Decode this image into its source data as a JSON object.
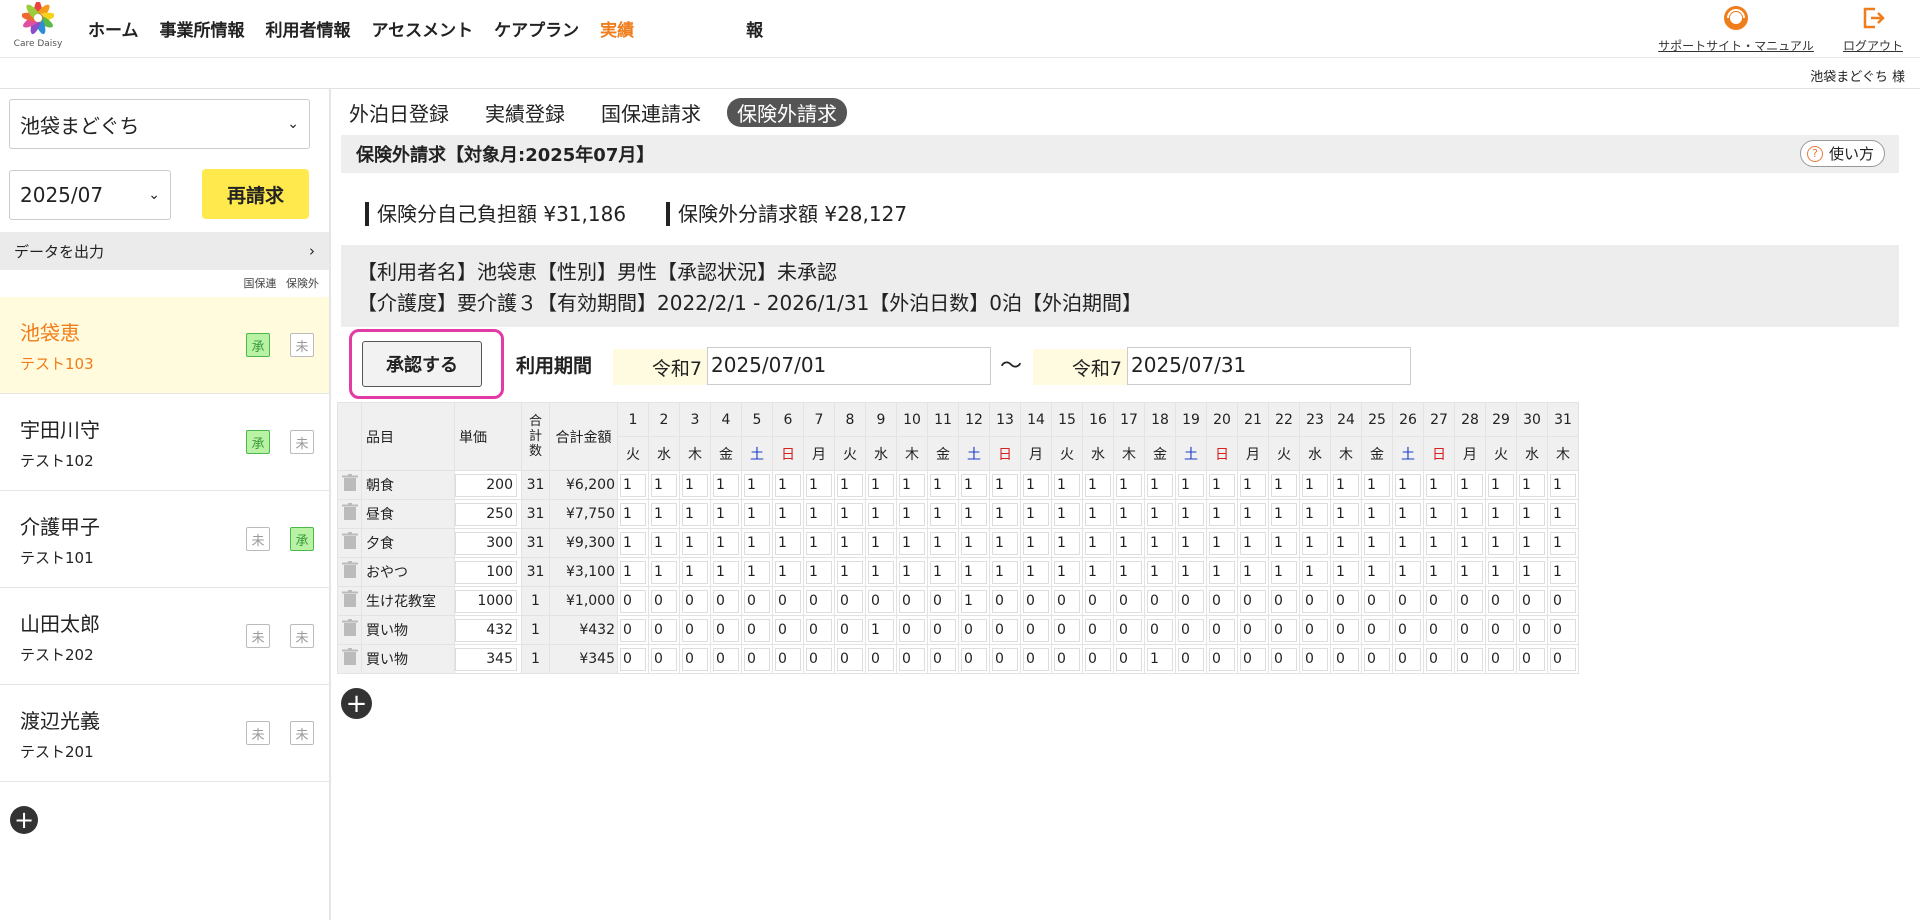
{
  "header": {
    "logo_text": "Care Daisy",
    "nav": [
      "ホーム",
      "事業所情報",
      "利用者情報",
      "アセスメント",
      "ケアプラン",
      "実績",
      "報"
    ],
    "support_label": "サポートサイト・マニュアル",
    "logout_label": "ログアウト",
    "user_label": "池袋まどぐち 様"
  },
  "sidebar": {
    "facility": "池袋まどぐち",
    "month": "2025/07",
    "rebill_label": "再請求",
    "export_label": "データを出力",
    "col_kokuho": "国保連",
    "col_hokengai": "保険外",
    "users": [
      {
        "name": "池袋恵",
        "code": "テスト103",
        "b1": "承",
        "b1_ok": true,
        "b2": "未",
        "b2_ok": false,
        "selected": true
      },
      {
        "name": "宇田川守",
        "code": "テスト102",
        "b1": "承",
        "b1_ok": true,
        "b2": "未",
        "b2_ok": false,
        "selected": false
      },
      {
        "name": "介護甲子",
        "code": "テスト101",
        "b1": "未",
        "b1_ok": false,
        "b2": "承",
        "b2_ok": true,
        "selected": false
      },
      {
        "name": "山田太郎",
        "code": "テスト202",
        "b1": "未",
        "b1_ok": false,
        "b2": "未",
        "b2_ok": false,
        "selected": false
      },
      {
        "name": "渡辺光義",
        "code": "テスト201",
        "b1": "未",
        "b1_ok": false,
        "b2": "未",
        "b2_ok": false,
        "selected": false
      }
    ]
  },
  "main": {
    "tabs": [
      "外泊日登録",
      "実績登録",
      "国保連請求",
      "保険外請求"
    ],
    "title": "保険外請求【対象月:2025年07月】",
    "help_label": "使い方",
    "insured_total": "保険分自己負担額 ¥31,186",
    "uninsured_total": "保険外分請求額 ¥28,127",
    "info_line1": "【利用者名】池袋恵【性別】男性【承認状況】未承認",
    "info_line2": "【介護度】要介護３【有効期間】2022/2/1 - 2026/1/31【外泊日数】0泊【外泊期間】",
    "approve_label": "承認する",
    "period_label": "利用期間",
    "era": "令和7",
    "start_date": "2025/07/01",
    "tilde": "〜",
    "end_date": "2025/07/31"
  },
  "grid": {
    "h_item": "品目",
    "h_price": "単価",
    "h_count": "合計数",
    "h_amount": "合計金額",
    "dows": [
      "火",
      "水",
      "木",
      "金",
      "土",
      "日",
      "月",
      "火",
      "水",
      "木",
      "金",
      "土",
      "日",
      "月",
      "火",
      "水",
      "木",
      "金",
      "土",
      "日",
      "月",
      "火",
      "水",
      "木",
      "金",
      "土",
      "日",
      "月",
      "火",
      "水",
      "木"
    ],
    "rows": [
      {
        "name": "朝食",
        "price": "200",
        "count": "31",
        "amount": "¥6,200",
        "qty": [
          1,
          1,
          1,
          1,
          1,
          1,
          1,
          1,
          1,
          1,
          1,
          1,
          1,
          1,
          1,
          1,
          1,
          1,
          1,
          1,
          1,
          1,
          1,
          1,
          1,
          1,
          1,
          1,
          1,
          1,
          1
        ]
      },
      {
        "name": "昼食",
        "price": "250",
        "count": "31",
        "amount": "¥7,750",
        "qty": [
          1,
          1,
          1,
          1,
          1,
          1,
          1,
          1,
          1,
          1,
          1,
          1,
          1,
          1,
          1,
          1,
          1,
          1,
          1,
          1,
          1,
          1,
          1,
          1,
          1,
          1,
          1,
          1,
          1,
          1,
          1
        ]
      },
      {
        "name": "夕食",
        "price": "300",
        "count": "31",
        "amount": "¥9,300",
        "qty": [
          1,
          1,
          1,
          1,
          1,
          1,
          1,
          1,
          1,
          1,
          1,
          1,
          1,
          1,
          1,
          1,
          1,
          1,
          1,
          1,
          1,
          1,
          1,
          1,
          1,
          1,
          1,
          1,
          1,
          1,
          1
        ]
      },
      {
        "name": "おやつ",
        "price": "100",
        "count": "31",
        "amount": "¥3,100",
        "qty": [
          1,
          1,
          1,
          1,
          1,
          1,
          1,
          1,
          1,
          1,
          1,
          1,
          1,
          1,
          1,
          1,
          1,
          1,
          1,
          1,
          1,
          1,
          1,
          1,
          1,
          1,
          1,
          1,
          1,
          1,
          1
        ]
      },
      {
        "name": "生け花教室",
        "price": "1000",
        "count": "1",
        "amount": "¥1,000",
        "qty": [
          0,
          0,
          0,
          0,
          0,
          0,
          0,
          0,
          0,
          0,
          0,
          1,
          0,
          0,
          0,
          0,
          0,
          0,
          0,
          0,
          0,
          0,
          0,
          0,
          0,
          0,
          0,
          0,
          0,
          0,
          0
        ]
      },
      {
        "name": "買い物",
        "price": "432",
        "count": "1",
        "amount": "¥432",
        "qty": [
          0,
          0,
          0,
          0,
          0,
          0,
          0,
          0,
          1,
          0,
          0,
          0,
          0,
          0,
          0,
          0,
          0,
          0,
          0,
          0,
          0,
          0,
          0,
          0,
          0,
          0,
          0,
          0,
          0,
          0,
          0
        ]
      },
      {
        "name": "買い物",
        "price": "345",
        "count": "1",
        "amount": "¥345",
        "qty": [
          0,
          0,
          0,
          0,
          0,
          0,
          0,
          0,
          0,
          0,
          0,
          0,
          0,
          0,
          0,
          0,
          0,
          1,
          0,
          0,
          0,
          0,
          0,
          0,
          0,
          0,
          0,
          0,
          0,
          0,
          0
        ]
      }
    ]
  }
}
